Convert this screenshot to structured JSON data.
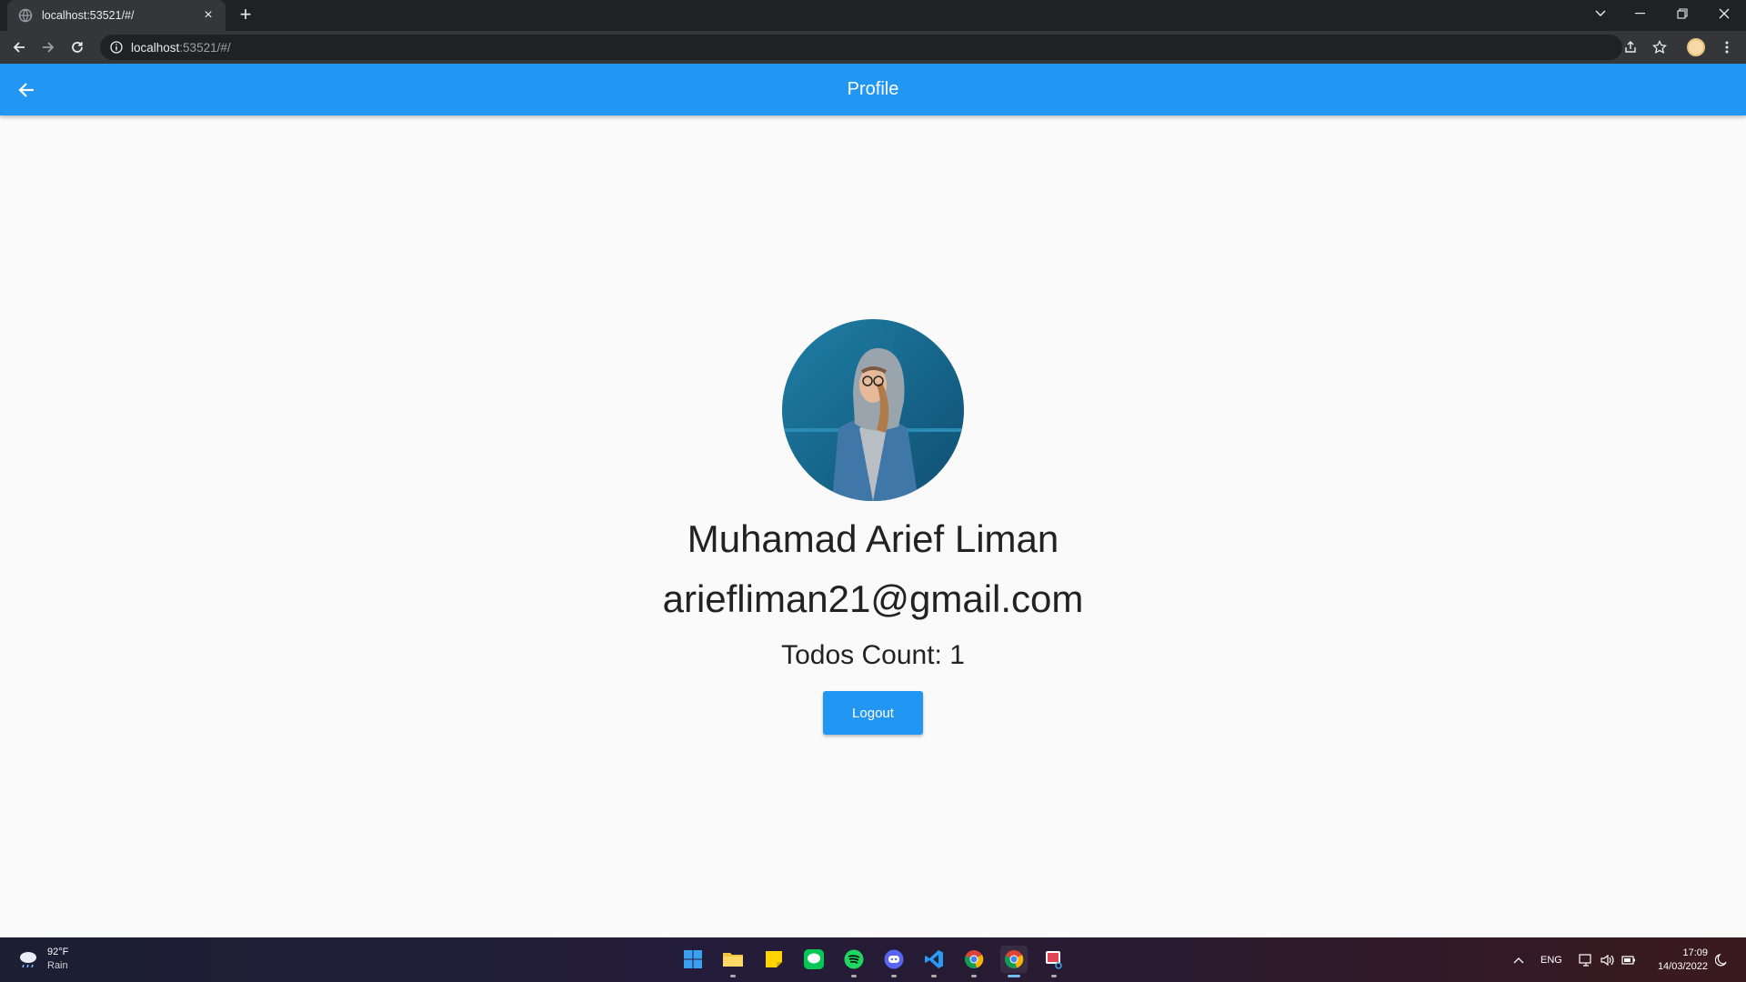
{
  "browser": {
    "tab_title": "localhost:53521/#/",
    "url_host": "localhost",
    "url_rest": ":53521/#/"
  },
  "appbar": {
    "title": "Profile"
  },
  "profile": {
    "name": "Muhamad Arief Liman",
    "email": "ariefliman21@gmail.com",
    "todos_count": "Todos Count: 1",
    "logout_label": "Logout"
  },
  "taskbar": {
    "weather_temp": "92°F",
    "weather_cond": "Rain",
    "language": "ENG",
    "time": "17:09",
    "date": "14/03/2022",
    "apps": [
      "start",
      "file-explorer",
      "sticky-notes",
      "line",
      "spotify",
      "discord",
      "vscode",
      "chrome",
      "chrome",
      "snipping-tool"
    ]
  },
  "colors": {
    "appbar": "#2196f3",
    "button": "#2196f3",
    "background": "#fafafa",
    "chrome_dark": "#202124"
  }
}
